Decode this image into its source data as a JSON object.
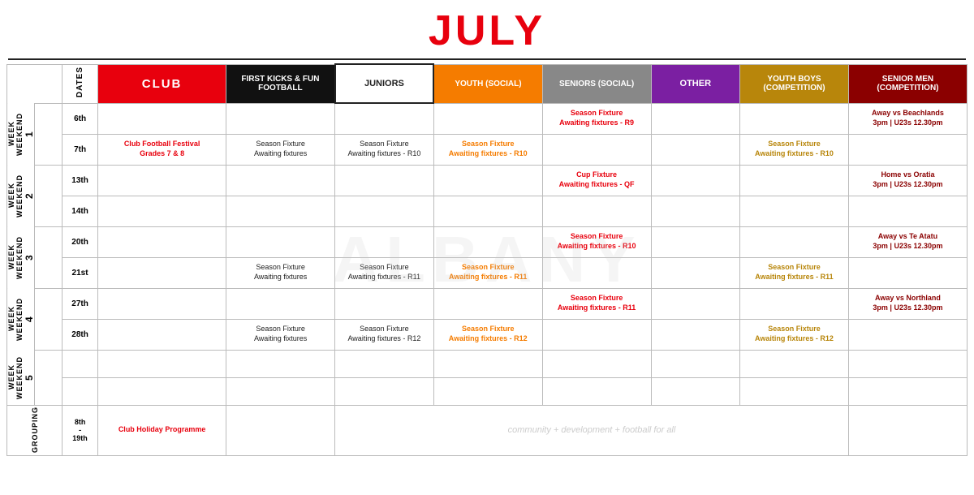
{
  "title": "JULY",
  "header": {
    "dates": "DATES",
    "club": "CLUB",
    "firstkicks": "FIRST KICKS & FUN FOOTBALL",
    "juniors": "JUNIORS",
    "youth": "YOUTH (SOCIAL)",
    "seniors": "SENIORS (SOCIAL)",
    "other": "OTHER",
    "youthboys": "YOUTH BOYS (COMPETITION)",
    "seniormen": "SENIOR MEN (COMPETITION)"
  },
  "weeks": [
    {
      "week_label": "WEEK 1",
      "sub_label": "WEEKEND",
      "rows": [
        {
          "date": "6th",
          "club": "",
          "firstkicks": "",
          "juniors": "",
          "youth": "",
          "seniors_line1": "Season Fixture",
          "seniors_line2": "Awaiting fixtures - R9",
          "other": "",
          "youthboys": "",
          "seniormen_line1": "Away vs Beachlands",
          "seniormen_line2": "3pm | U23s 12.30pm"
        },
        {
          "date": "7th",
          "club_line1": "Club Football Festival",
          "club_line2": "Grades 7 & 8",
          "firstkicks_line1": "Season Fixture",
          "firstkicks_line2": "Awaiting fixtures",
          "juniors_line1": "Season Fixture",
          "juniors_line2": "Awaiting fixtures - R10",
          "youth_line1": "Season Fixture",
          "youth_line2": "Awaiting fixtures - R10",
          "seniors": "",
          "other": "",
          "youthboys_line1": "Season Fixture",
          "youthboys_line2": "Awaiting fixtures - R10",
          "seniormen": ""
        }
      ]
    },
    {
      "week_label": "WEEK 2",
      "sub_label": "WEEKEND",
      "rows": [
        {
          "date": "13th",
          "club": "",
          "firstkicks": "",
          "juniors": "",
          "youth": "",
          "seniors_line1": "Cup Fixture",
          "seniors_line2": "Awaiting fixtures - QF",
          "other": "",
          "youthboys": "",
          "seniormen_line1": "Home vs Oratia",
          "seniormen_line2": "3pm | U23s 12.30pm"
        },
        {
          "date": "14th",
          "club": "",
          "firstkicks": "",
          "juniors": "",
          "youth": "",
          "seniors": "",
          "other": "",
          "youthboys": "",
          "seniormen": ""
        }
      ]
    },
    {
      "week_label": "WEEK 3",
      "sub_label": "WEEKEND",
      "rows": [
        {
          "date": "20th",
          "club": "",
          "firstkicks": "",
          "juniors": "",
          "youth": "",
          "seniors_line1": "Season Fixture",
          "seniors_line2": "Awaiting fixtures - R10",
          "other": "",
          "youthboys": "",
          "seniormen_line1": "Away vs Te Atatu",
          "seniormen_line2": "3pm | U23s 12.30pm"
        },
        {
          "date": "21st",
          "club": "",
          "firstkicks_line1": "Season Fixture",
          "firstkicks_line2": "Awaiting fixtures",
          "juniors_line1": "Season Fixture",
          "juniors_line2": "Awaiting fixtures - R11",
          "youth_line1": "Season Fixture",
          "youth_line2": "Awaiting fixtures - R11",
          "seniors": "",
          "other": "",
          "youthboys_line1": "Season Fixture",
          "youthboys_line2": "Awaiting fixtures - R11",
          "seniormen": ""
        }
      ]
    },
    {
      "week_label": "WEEK 4",
      "sub_label": "WEEKEND",
      "rows": [
        {
          "date": "27th",
          "club": "",
          "firstkicks": "",
          "juniors": "",
          "youth": "",
          "seniors_line1": "Season Fixture",
          "seniors_line2": "Awaiting fixtures - R11",
          "other": "",
          "youthboys": "",
          "seniormen_line1": "Away vs Northland",
          "seniormen_line2": "3pm | U23s 12.30pm"
        },
        {
          "date": "28th",
          "club": "",
          "firstkicks_line1": "Season Fixture",
          "firstkicks_line2": "Awaiting fixtures",
          "juniors_line1": "Season Fixture",
          "juniors_line2": "Awaiting fixtures - R12",
          "youth_line1": "Season Fixture",
          "youth_line2": "Awaiting fixtures - R12",
          "seniors": "",
          "other": "",
          "youthboys_line1": "Season Fixture",
          "youthboys_line2": "Awaiting fixtures - R12",
          "seniormen": ""
        }
      ]
    },
    {
      "week_label": "WEEK 5",
      "sub_label": "WEEKEND",
      "rows": [
        {
          "date": "",
          "club": "",
          "firstkicks": "",
          "juniors": "",
          "youth": "",
          "seniors": "",
          "other": "",
          "youthboys": "",
          "seniormen": ""
        },
        {
          "date": "",
          "club": "",
          "firstkicks": "",
          "juniors": "",
          "youth": "",
          "seniors": "",
          "other": "",
          "youthboys": "",
          "seniormen": ""
        }
      ]
    }
  ],
  "grouping": {
    "label": "GROUPING",
    "date_start": "8th",
    "date_sep": "-",
    "date_end": "19th",
    "club": "Club Holiday Programme",
    "italic_text": "community + development + football for all"
  }
}
